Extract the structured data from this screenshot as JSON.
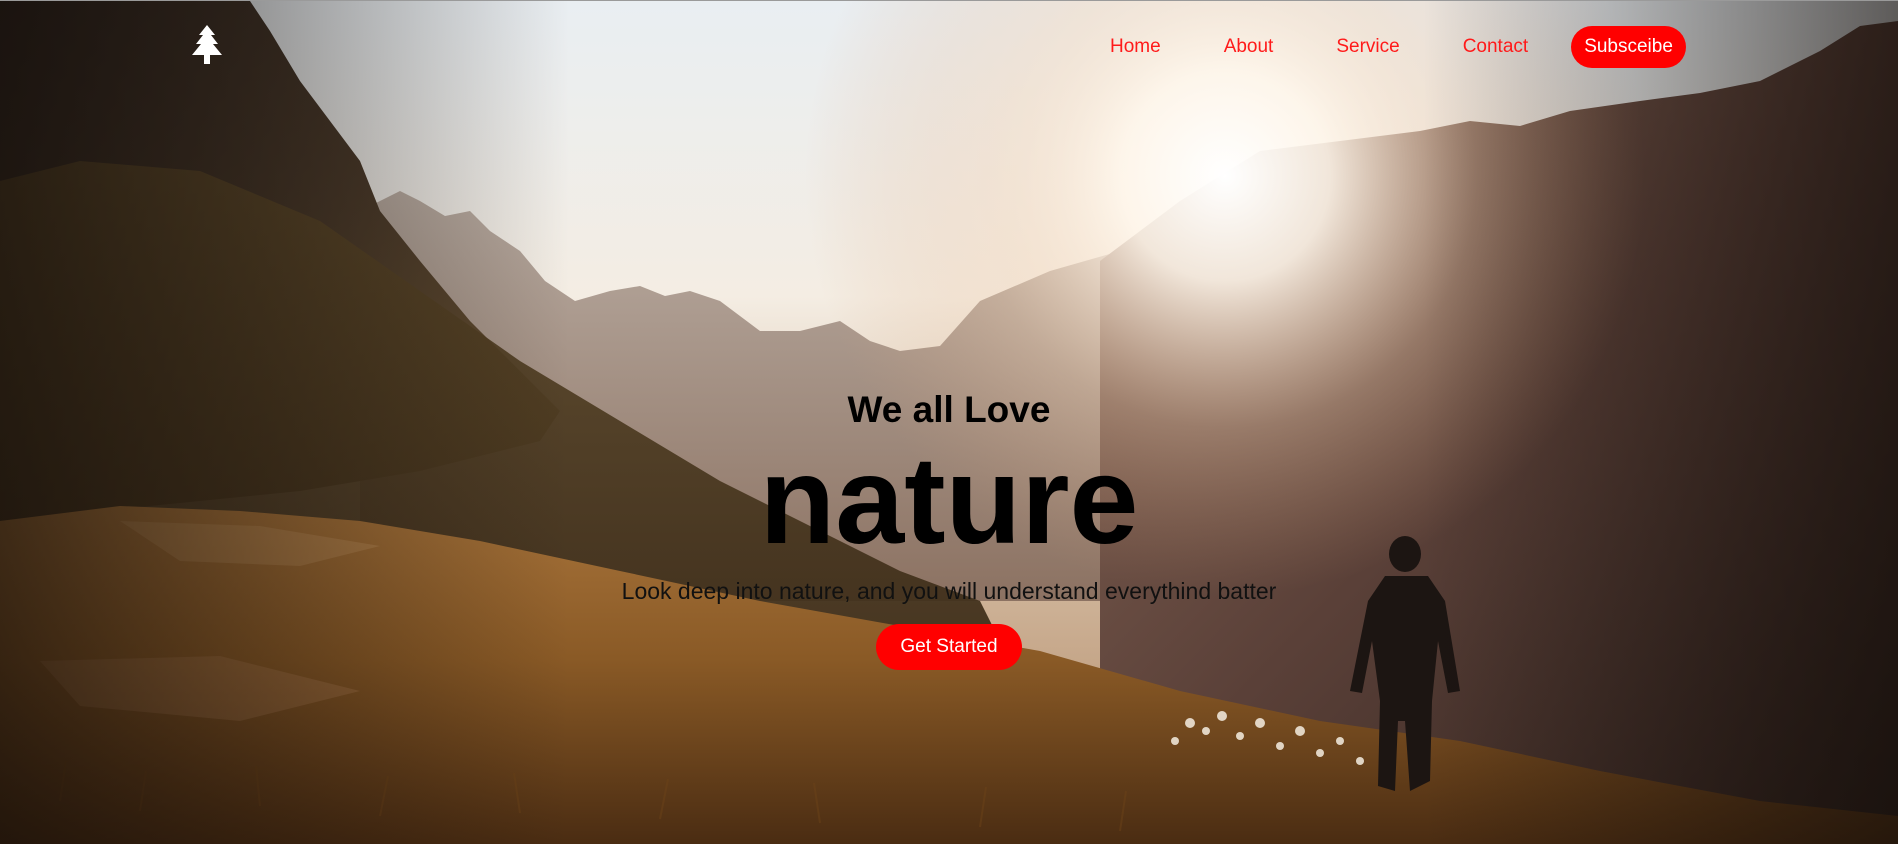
{
  "nav": {
    "items": [
      {
        "label": "Home"
      },
      {
        "label": "About"
      },
      {
        "label": "Service"
      },
      {
        "label": "Contact"
      }
    ],
    "subscribe_label": "Subsceibe"
  },
  "hero": {
    "eyebrow": "We all Love",
    "headline": "nature",
    "tagline": "Look deep into nature, and you will understand everythind batter",
    "cta_label": "Get Started"
  },
  "icons": {
    "logo": "pine-tree-icon"
  },
  "colors": {
    "accent": "#ff0000",
    "heading": "#000000",
    "button_text": "#ffffff"
  }
}
